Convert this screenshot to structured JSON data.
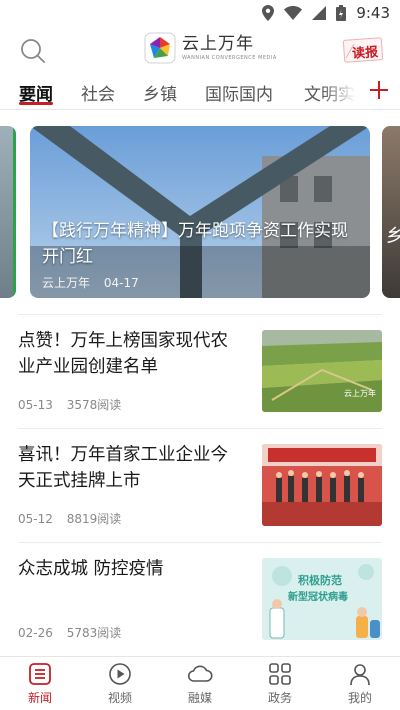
{
  "status_bar": {
    "time": "9:43"
  },
  "header": {
    "brand_name": "云上万年",
    "brand_sub": "WANNIAN CONVERGENCE MEDIA",
    "read_button_label": "读报"
  },
  "tabs": [
    "要闻",
    "社会",
    "乡镇",
    "国际国内",
    "文明实"
  ],
  "active_tab": "要闻",
  "banner": {
    "title": "【践行万年精神】万年跑项争资工作实现开门红",
    "source": "云上万年",
    "date": "04-17",
    "side_right_text": "乡"
  },
  "news": [
    {
      "title": "点赞！万年上榜国家现代农业产业园创建名单",
      "date": "05-13",
      "reads": "3578阅读",
      "thumb": "farmland",
      "thumb_caption": "云上万年"
    },
    {
      "title": "喜讯！万年首家工业企业今天正式挂牌上市",
      "date": "05-12",
      "reads": "8819阅读",
      "thumb": "ceremony-stage"
    },
    {
      "title": "众志成城 防控疫情",
      "date": "02-26",
      "reads": "5783阅读",
      "thumb": "epidemic-poster",
      "thumb_caption_line1": "积极防范",
      "thumb_caption_line2": "新型冠状病毒"
    }
  ],
  "bottom_nav": [
    {
      "label": "新闻",
      "icon": "news-icon",
      "active": true
    },
    {
      "label": "视频",
      "icon": "play-icon",
      "active": false
    },
    {
      "label": "融媒",
      "icon": "cloud-icon",
      "active": false
    },
    {
      "label": "政务",
      "icon": "grid-icon",
      "active": false
    },
    {
      "label": "我的",
      "icon": "person-icon",
      "active": false
    }
  ],
  "colors": {
    "accent": "#c81d25",
    "text": "#1a1a1a",
    "meta": "#888888"
  }
}
